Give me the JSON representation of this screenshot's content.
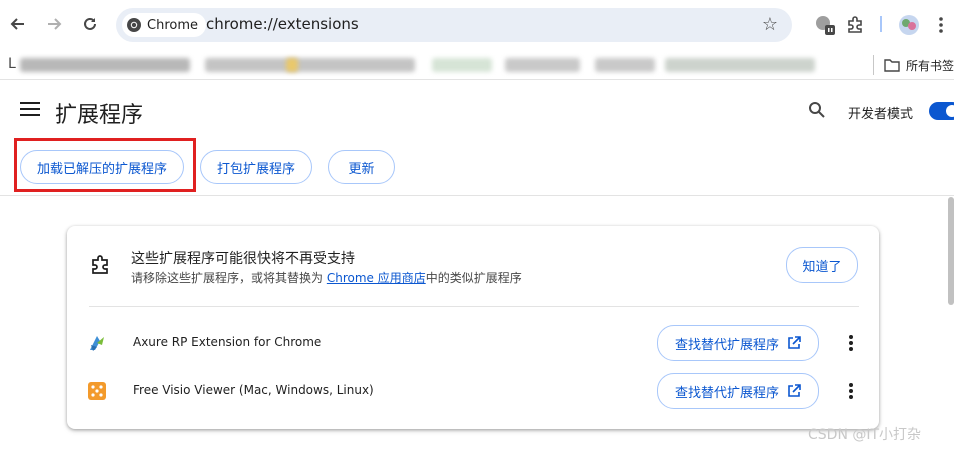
{
  "toolbar": {
    "chip_label": "Chrome",
    "url": "chrome://extensions"
  },
  "bookmarks": {
    "all_bookmarks_label": "所有书签"
  },
  "header": {
    "title": "扩展程序",
    "dev_mode_label": "开发者模式",
    "dev_mode_on": true
  },
  "actions": {
    "load_unpacked": "加载已解压的扩展程序",
    "pack": "打包扩展程序",
    "update": "更新"
  },
  "warning": {
    "title": "这些扩展程序可能很快将不再受支持",
    "desc_before": "请移除这些扩展程序，或将其替换为 ",
    "desc_link": "Chrome 应用商店",
    "desc_after": "中的类似扩展程序",
    "got_it": "知道了"
  },
  "extensions": [
    {
      "name": "Axure RP Extension for Chrome",
      "icon": "axure-icon",
      "action": "查找替代扩展程序"
    },
    {
      "name": "Free Visio Viewer (Mac, Windows, Linux)",
      "icon": "visio-viewer-icon",
      "action": "查找替代扩展程序"
    }
  ],
  "watermark": "CSDN @IT小打杂",
  "colors": {
    "accent": "#0b57d0",
    "pill_border": "#a8c7fa",
    "highlight_box": "#e02020",
    "omnibox_bg": "#e9eef6"
  }
}
